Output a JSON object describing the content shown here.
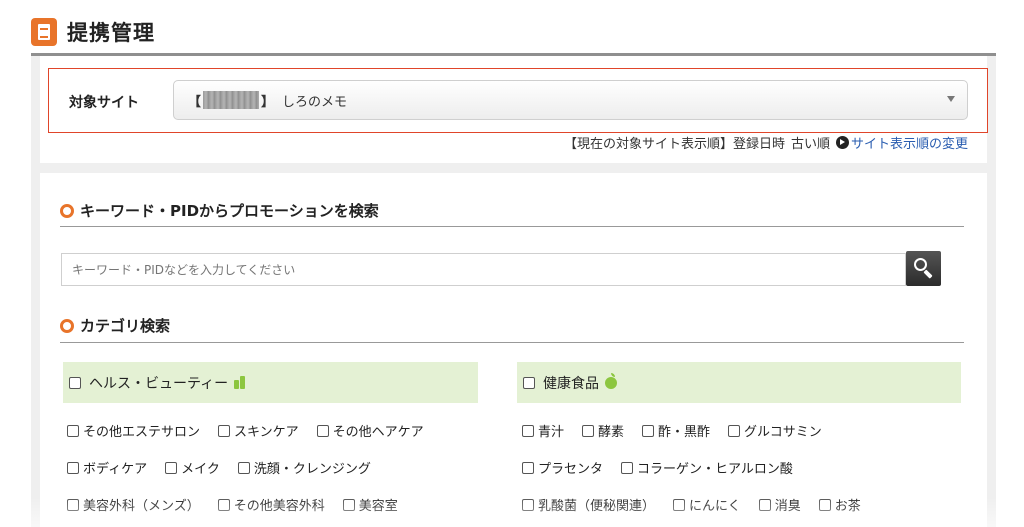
{
  "page": {
    "title": "提携管理"
  },
  "site": {
    "label": "対象サイト",
    "selected_left_bracket": "【",
    "selected_right_bracket": "】",
    "selected_name": "しろのメモ",
    "order_prefix": "【現在の対象サイト表示順】登録日時",
    "order_value": "古い順",
    "order_link": "サイト表示順の変更"
  },
  "keyword_search": {
    "heading": "キーワード・PIDからプロモーションを検索",
    "placeholder": "キーワード・PIDなどを入力してください"
  },
  "category_search": {
    "heading": "カテゴリ検索",
    "groups": [
      {
        "name": "ヘルス・ビューティー",
        "icon": "bottle-icon",
        "rows": [
          [
            "その他エステサロン",
            "スキンケア",
            "その他ヘアケア"
          ],
          [
            "ボディケア",
            "メイク",
            "洗顔・クレンジング"
          ],
          [
            "美容外科（メンズ）",
            "その他美容外科",
            "美容室"
          ]
        ]
      },
      {
        "name": "健康食品",
        "icon": "apple-icon",
        "rows": [
          [
            "青汁",
            "酵素",
            "酢・黒酢",
            "グルコサミン"
          ],
          [
            "プラセンタ",
            "コラーゲン・ヒアルロン酸"
          ],
          [
            "乳酸菌（便秘関連）",
            "にんにく",
            "消臭",
            "お茶"
          ]
        ]
      }
    ]
  },
  "colors": {
    "accent": "#e8742a",
    "highlight_border": "#e0452a",
    "category_bg": "#e4f1d4",
    "link": "#2a5db0",
    "icon_green": "#8cc63f"
  }
}
